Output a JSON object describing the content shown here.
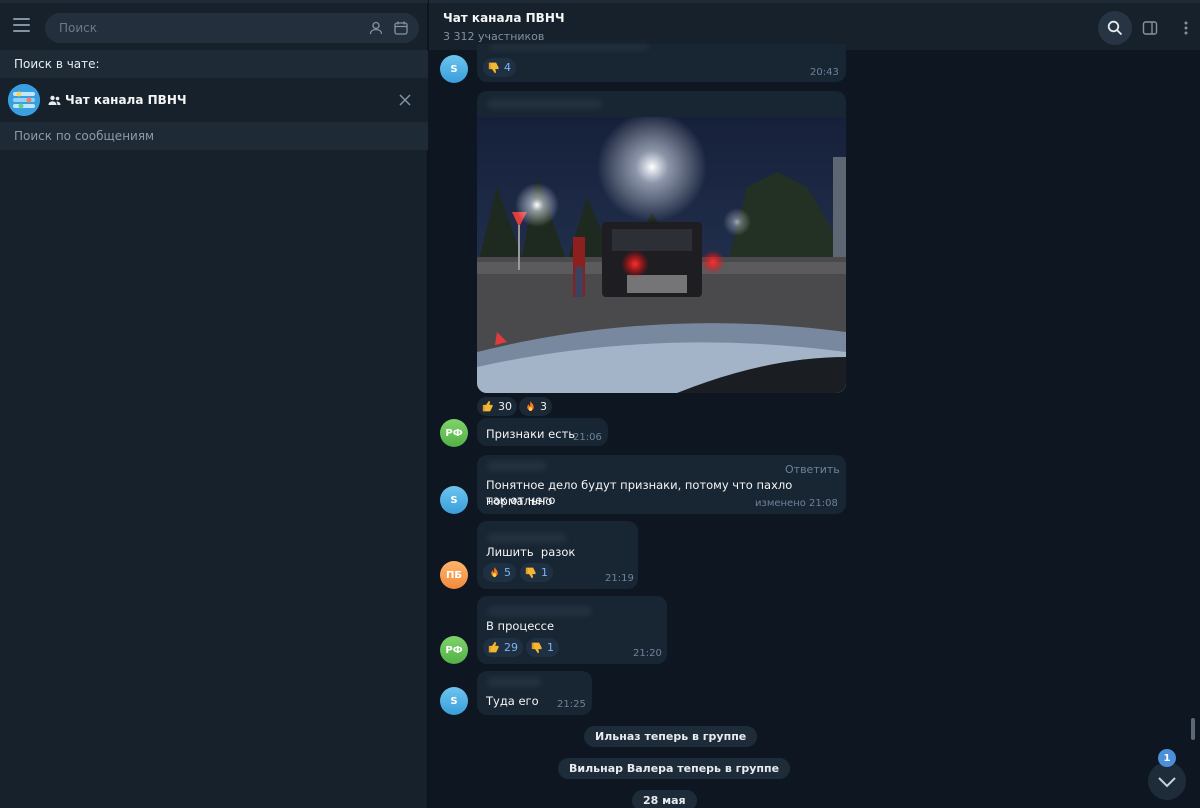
{
  "sidebar": {
    "search_placeholder": "Поиск",
    "search_in_chat_label": "Поиск в чате:",
    "chat_name": "Чат канала ПВНЧ",
    "search_messages_label": "Поиск по сообщениям"
  },
  "header": {
    "title": "Чат канала ПВНЧ",
    "subtitle": "3 312 участников"
  },
  "messages": [
    {
      "avatar": "S",
      "reactions": [
        {
          "icon": "thumbs-down",
          "count": "4"
        }
      ],
      "time": "20:43"
    },
    {
      "avatar": "",
      "reactions": [
        {
          "icon": "thumbs-up",
          "count": "30"
        },
        {
          "icon": "fire",
          "count": "3"
        }
      ]
    },
    {
      "avatar": "РФ",
      "text": "Признаки есть",
      "time": "21:06"
    },
    {
      "avatar": "S",
      "reply_label": "Ответить",
      "text_line1": "Понятное дело будут признаки, потому что пахло нормально",
      "text_line2": "так от него",
      "time": "изменено 21:08"
    },
    {
      "avatar": "ПБ",
      "text": "Лишить  разок",
      "reactions": [
        {
          "icon": "fire",
          "count": "5"
        },
        {
          "icon": "thumbs-down",
          "count": "1"
        }
      ],
      "time": "21:19"
    },
    {
      "avatar": "РФ",
      "text": "В процессе",
      "reactions": [
        {
          "icon": "thumbs-up",
          "count": "29"
        },
        {
          "icon": "thumbs-down",
          "count": "1"
        }
      ],
      "time": "21:20"
    },
    {
      "avatar": "S",
      "text": "Туда его",
      "time": "21:25"
    }
  ],
  "service_messages": [
    "Ильназ теперь в группе",
    "Вильнар Валера теперь в группе",
    "28 мая"
  ],
  "scroll_down_badge": "1",
  "colors": {
    "left_bg": "#17212b",
    "chat_bg": "#0e1621",
    "bubble": "#182533",
    "accent": "#4b8fdb"
  }
}
